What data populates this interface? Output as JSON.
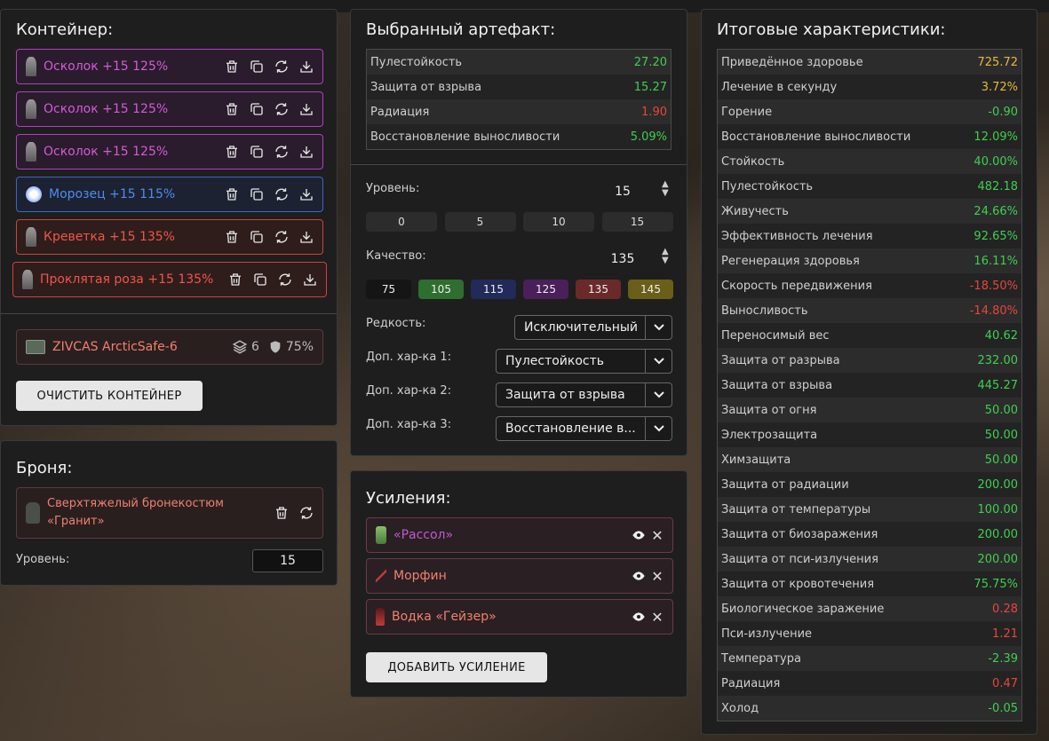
{
  "container": {
    "title": "Контейнер:",
    "artifacts": [
      {
        "name": "Осколок +15 125%",
        "tier": "purple"
      },
      {
        "name": "Осколок +15 125%",
        "tier": "purple"
      },
      {
        "name": "Осколок +15 125%",
        "tier": "purple"
      },
      {
        "name": "Морозец +15 115%",
        "tier": "blue"
      },
      {
        "name": "Креветка +15 135%",
        "tier": "red"
      },
      {
        "name": "Проклятая роза +15 135%",
        "tier": "red"
      }
    ],
    "container_item": {
      "name": "ZIVCAS ArcticSafe-6",
      "slots": "6",
      "protection": "75%"
    },
    "clear_button": "ОЧИСТИТЬ КОНТЕЙНЕР"
  },
  "armor": {
    "title": "Броня:",
    "name_line1": "Сверхтяжелый бронекостюм",
    "name_line2": "«Гранит»",
    "level_label": "Уровень:",
    "level_value": "15"
  },
  "selected": {
    "title": "Выбранный артефакт:",
    "stats": [
      {
        "label": "Пулестойкость",
        "value": "27.20",
        "color": "green"
      },
      {
        "label": "Защита от взрыва",
        "value": "15.27",
        "color": "green"
      },
      {
        "label": "Радиация",
        "value": "1.90",
        "color": "red"
      },
      {
        "label": "Восстановление выносливости",
        "value": "5.09%",
        "color": "green"
      }
    ],
    "level_label": "Уровень:",
    "level_value": "15",
    "level_presets": [
      "0",
      "5",
      "10",
      "15"
    ],
    "quality_label": "Качество:",
    "quality_value": "135",
    "quality_presets": [
      {
        "label": "75",
        "color": "#151515"
      },
      {
        "label": "105",
        "color": "#2e6e2e"
      },
      {
        "label": "115",
        "color": "#222a5a"
      },
      {
        "label": "125",
        "color": "#4a1f5a"
      },
      {
        "label": "135",
        "color": "#6a2a2a"
      },
      {
        "label": "145",
        "color": "#6a5f18"
      }
    ],
    "rarity_label": "Редкость:",
    "rarity_value": "Исключительный",
    "extra1_label": "Доп. хар-ка 1:",
    "extra1_value": "Пулестойкость",
    "extra2_label": "Доп. хар-ка 2:",
    "extra2_value": "Защита от взрыва",
    "extra3_label": "Доп. хар-ка 3:",
    "extra3_value": "Восстановление в..."
  },
  "boosts": {
    "title": "Усиления:",
    "items": [
      {
        "name": "«Рассол»",
        "color": "#c05ad0"
      },
      {
        "name": "Морфин",
        "color": "#f08070"
      },
      {
        "name": "Водка «Гейзер»",
        "color": "#f08070"
      }
    ],
    "add_button": "ДОБАВИТЬ УСИЛЕНИЕ"
  },
  "totals": {
    "title": "Итоговые характеристики:",
    "stats": [
      {
        "label": "Приведённое здоровье",
        "value": "725.72",
        "color": "yellow"
      },
      {
        "label": "Лечение в секунду",
        "value": "3.72%",
        "color": "yellow"
      },
      {
        "label": "Горение",
        "value": "-0.90",
        "color": "green"
      },
      {
        "label": "Восстановление выносливости",
        "value": "12.09%",
        "color": "green"
      },
      {
        "label": "Стойкость",
        "value": "40.00%",
        "color": "green"
      },
      {
        "label": "Пулестойкость",
        "value": "482.18",
        "color": "green"
      },
      {
        "label": "Живучесть",
        "value": "24.66%",
        "color": "green"
      },
      {
        "label": "Эффективность лечения",
        "value": "92.65%",
        "color": "green"
      },
      {
        "label": "Регенерация здоровья",
        "value": "16.11%",
        "color": "green"
      },
      {
        "label": "Скорость передвижения",
        "value": "-18.50%",
        "color": "red"
      },
      {
        "label": "Выносливость",
        "value": "-14.80%",
        "color": "red"
      },
      {
        "label": "Переносимый вес",
        "value": "40.62",
        "color": "green"
      },
      {
        "label": "Защита от разрыва",
        "value": "232.00",
        "color": "green"
      },
      {
        "label": "Защита от взрыва",
        "value": "445.27",
        "color": "green"
      },
      {
        "label": "Защита от огня",
        "value": "50.00",
        "color": "green"
      },
      {
        "label": "Электрозащита",
        "value": "50.00",
        "color": "green"
      },
      {
        "label": "Химзащита",
        "value": "50.00",
        "color": "green"
      },
      {
        "label": "Защита от радиации",
        "value": "200.00",
        "color": "green"
      },
      {
        "label": "Защита от температуры",
        "value": "100.00",
        "color": "green"
      },
      {
        "label": "Защита от биозаражения",
        "value": "200.00",
        "color": "green"
      },
      {
        "label": "Защита от пси-излучения",
        "value": "200.00",
        "color": "green"
      },
      {
        "label": "Защита от кровотечения",
        "value": "75.75%",
        "color": "green"
      },
      {
        "label": "Биологическое заражение",
        "value": "0.28",
        "color": "red"
      },
      {
        "label": "Пси-излучение",
        "value": "1.21",
        "color": "red"
      },
      {
        "label": "Температура",
        "value": "-2.39",
        "color": "green"
      },
      {
        "label": "Радиация",
        "value": "0.47",
        "color": "red"
      },
      {
        "label": "Холод",
        "value": "-0.05",
        "color": "green"
      }
    ]
  }
}
